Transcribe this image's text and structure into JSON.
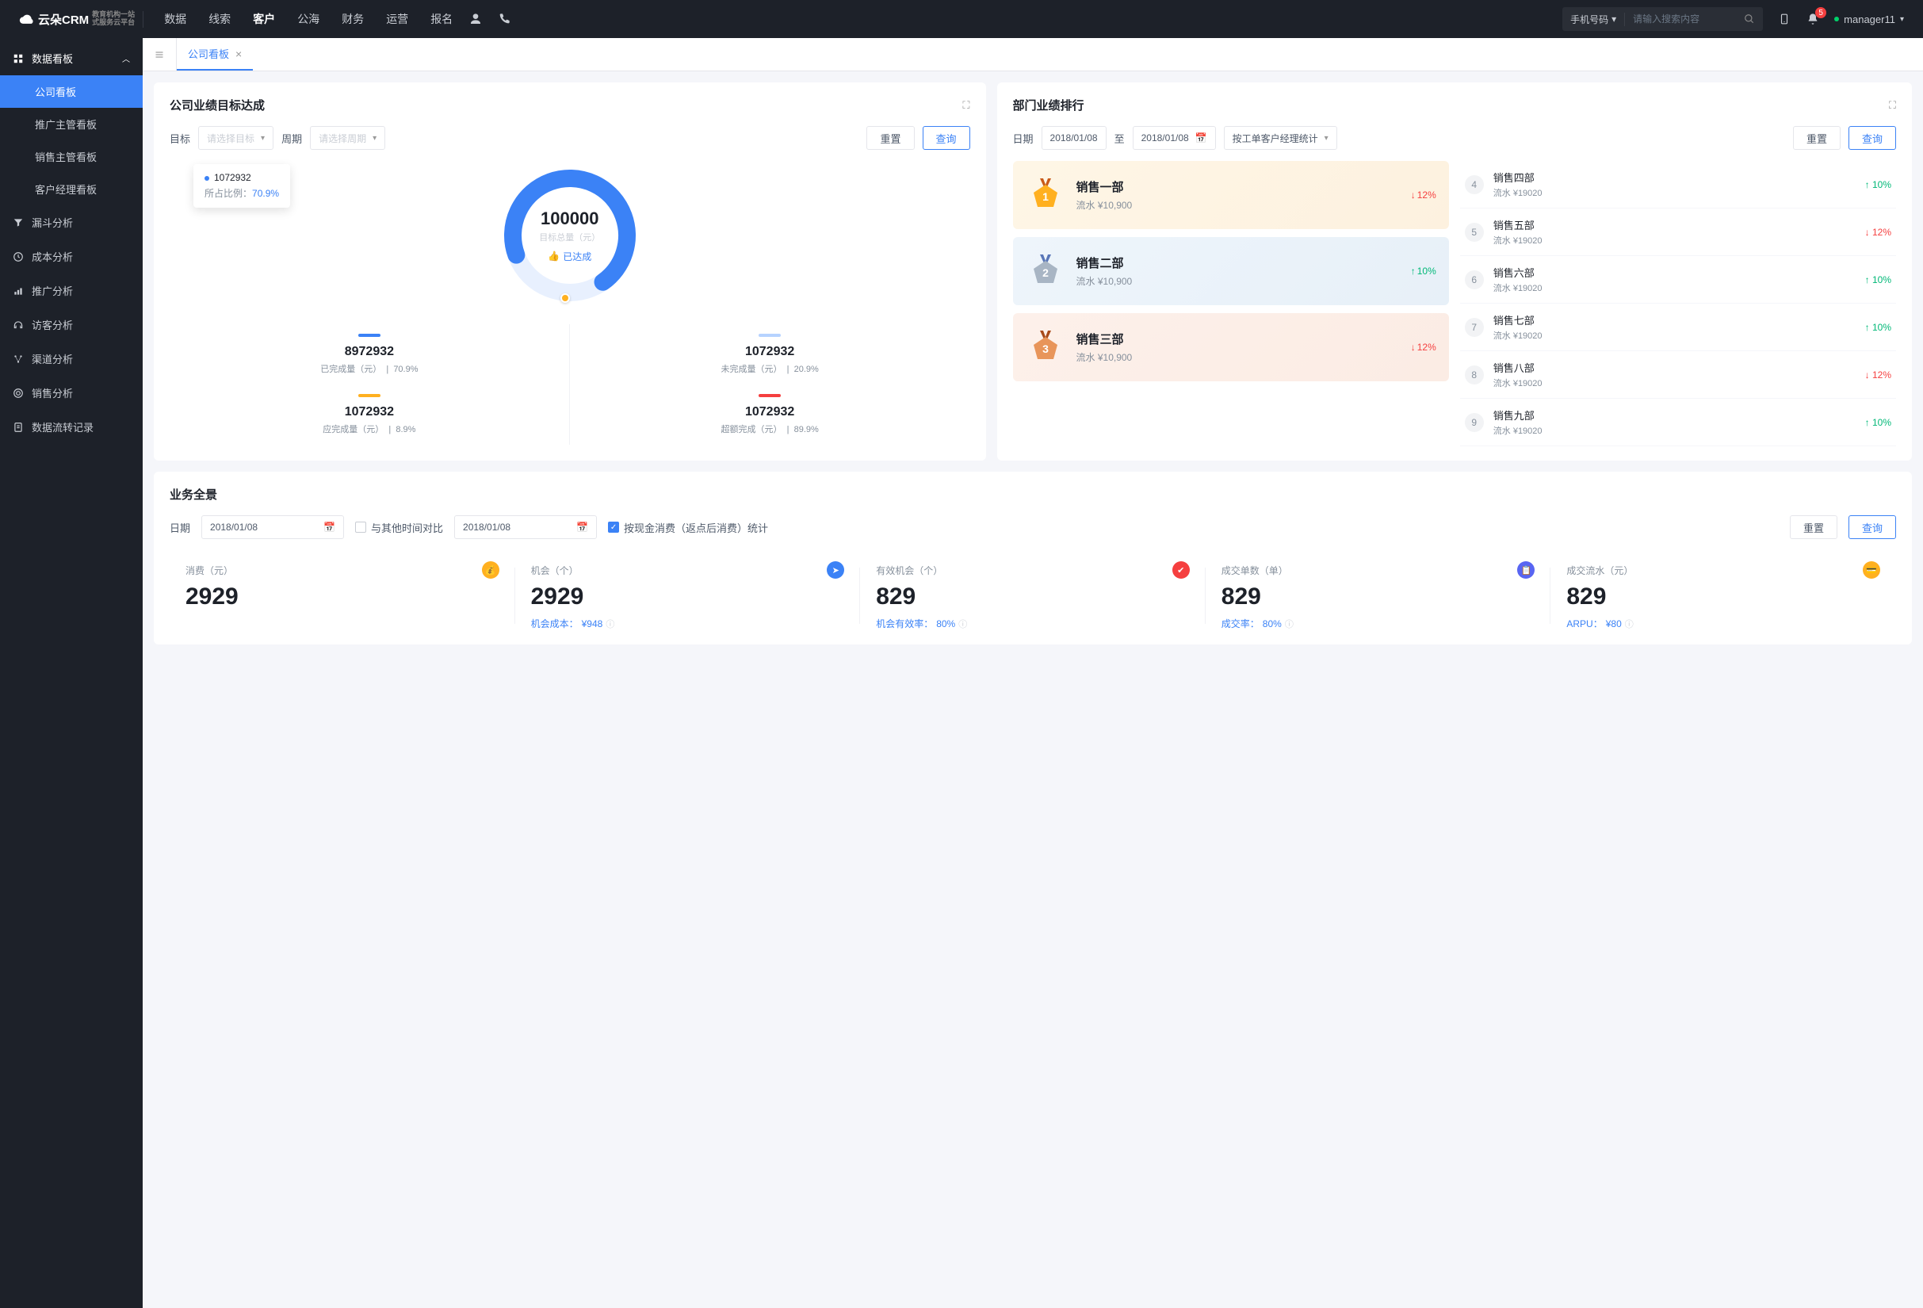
{
  "brand": {
    "name": "云朵CRM",
    "sub1": "教育机构一站",
    "sub2": "式服务云平台"
  },
  "nav": {
    "items": [
      "数据",
      "线索",
      "客户",
      "公海",
      "财务",
      "运营",
      "报名"
    ],
    "active": "客户"
  },
  "search": {
    "type": "手机号码",
    "placeholder": "请输入搜索内容"
  },
  "badge": "5",
  "user": "manager11",
  "sidebar": {
    "header": "数据看板",
    "subs": [
      "公司看板",
      "推广主管看板",
      "销售主管看板",
      "客户经理看板"
    ],
    "items": [
      "漏斗分析",
      "成本分析",
      "推广分析",
      "访客分析",
      "渠道分析",
      "销售分析",
      "数据流转记录"
    ]
  },
  "tab": {
    "label": "公司看板"
  },
  "target": {
    "title": "公司业绩目标达成",
    "labels": {
      "target": "目标",
      "period": "周期",
      "target_ph": "请选择目标",
      "period_ph": "请选择周期",
      "reset": "重置",
      "query": "查询"
    },
    "tooltip": {
      "value": "1072932",
      "ratio_label": "所占比例：",
      "ratio": "70.9%"
    },
    "donut": {
      "total": "100000",
      "total_label": "目标总量（元）",
      "status": "已达成"
    },
    "stats": [
      {
        "color": "#3b82f6",
        "value": "8972932",
        "label": "已完成量（元）",
        "pct": "70.9%"
      },
      {
        "color": "#b6d3ff",
        "value": "1072932",
        "label": "未完成量（元）",
        "pct": "20.9%"
      },
      {
        "color": "#ffb020",
        "value": "1072932",
        "label": "应完成量（元）",
        "pct": "8.9%"
      },
      {
        "color": "#f53f3f",
        "value": "1072932",
        "label": "超额完成（元）",
        "pct": "89.9%"
      }
    ]
  },
  "ranking": {
    "title": "部门业绩排行",
    "labels": {
      "date": "日期",
      "to": "至",
      "mode": "按工单客户经理统计",
      "reset": "重置",
      "query": "查询"
    },
    "date_from": "2018/01/08",
    "date_to": "2018/01/08",
    "top": [
      {
        "rank": "1",
        "name": "销售一部",
        "sub": "流水 ¥10,900",
        "pct": "12%",
        "dir": "down"
      },
      {
        "rank": "2",
        "name": "销售二部",
        "sub": "流水 ¥10,900",
        "pct": "10%",
        "dir": "up"
      },
      {
        "rank": "3",
        "name": "销售三部",
        "sub": "流水 ¥10,900",
        "pct": "12%",
        "dir": "down"
      }
    ],
    "rest": [
      {
        "rank": "4",
        "name": "销售四部",
        "sub": "流水 ¥19020",
        "pct": "10%",
        "dir": "up"
      },
      {
        "rank": "5",
        "name": "销售五部",
        "sub": "流水 ¥19020",
        "pct": "12%",
        "dir": "down"
      },
      {
        "rank": "6",
        "name": "销售六部",
        "sub": "流水 ¥19020",
        "pct": "10%",
        "dir": "up"
      },
      {
        "rank": "7",
        "name": "销售七部",
        "sub": "流水 ¥19020",
        "pct": "10%",
        "dir": "up"
      },
      {
        "rank": "8",
        "name": "销售八部",
        "sub": "流水 ¥19020",
        "pct": "12%",
        "dir": "down"
      },
      {
        "rank": "9",
        "name": "销售九部",
        "sub": "流水 ¥19020",
        "pct": "10%",
        "dir": "up"
      }
    ]
  },
  "biz": {
    "title": "业务全景",
    "labels": {
      "date": "日期",
      "compare": "与其他时间对比",
      "check_label": "按现金消费（返点后消费）统计",
      "reset": "重置",
      "query": "查询"
    },
    "date1": "2018/01/08",
    "date2": "2018/01/08",
    "metrics": [
      {
        "label": "消费（元）",
        "value": "2929",
        "icon_bg": "#ffb020",
        "icon": "💰",
        "sub": ""
      },
      {
        "label": "机会（个）",
        "value": "2929",
        "icon_bg": "#3b82f6",
        "icon": "➤",
        "sub_label": "机会成本：",
        "sub_val": "¥948"
      },
      {
        "label": "有效机会（个）",
        "value": "829",
        "icon_bg": "#f53f3f",
        "icon": "✔",
        "sub_label": "机会有效率：",
        "sub_val": "80%"
      },
      {
        "label": "成交单数（单）",
        "value": "829",
        "icon_bg": "#5865f2",
        "icon": "📋",
        "sub_label": "成交率：",
        "sub_val": "80%"
      },
      {
        "label": "成交流水（元）",
        "value": "829",
        "icon_bg": "#ffb020",
        "icon": "💳",
        "sub_label": "ARPU：",
        "sub_val": "¥80"
      }
    ]
  },
  "chart_data": {
    "type": "pie",
    "title": "目标总量（元）",
    "total": 100000,
    "series": [
      {
        "name": "已完成量（元）",
        "value": 8972932,
        "pct": 70.9,
        "color": "#3b82f6"
      },
      {
        "name": "未完成量（元）",
        "value": 1072932,
        "pct": 20.9,
        "color": "#b6d3ff"
      },
      {
        "name": "应完成量（元）",
        "value": 1072932,
        "pct": 8.9,
        "color": "#ffb020"
      },
      {
        "name": "超额完成（元）",
        "value": 1072932,
        "pct": 89.9,
        "color": "#f53f3f"
      }
    ]
  }
}
